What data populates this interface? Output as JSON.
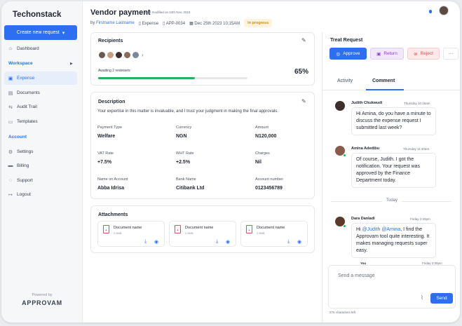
{
  "sidebar": {
    "brand": "Techonstack",
    "new_request": "Create new request",
    "items": [
      {
        "label": "Dashboard",
        "icon": "home-icon"
      },
      {
        "label": "Expense",
        "icon": "wallet-icon"
      },
      {
        "label": "Documents",
        "icon": "file-icon"
      },
      {
        "label": "Audit Trail",
        "icon": "audit-icon"
      },
      {
        "label": "Templates",
        "icon": "template-icon"
      },
      {
        "label": "Settings",
        "icon": "gear-icon"
      },
      {
        "label": "Billing",
        "icon": "card-icon"
      },
      {
        "label": "Support",
        "icon": "support-icon"
      },
      {
        "label": "Logout",
        "icon": "logout-icon"
      }
    ],
    "section_workspace": "Workspace",
    "section_account": "Account",
    "powered_by": "Powered by",
    "product": "APPROVAM"
  },
  "header": {
    "title": "Vendor payment",
    "modified": "Last modified on 24th Nov, 2024",
    "by": "by",
    "author": "Firstname Lastname",
    "category": "Expense",
    "request_id": "APP-0034",
    "date": "Dec 25th 2023 10:15AM",
    "status": "In progress"
  },
  "recipients": {
    "title": "Recipients",
    "awaiting": "Awaiting 2 reviewers",
    "progress_pct": 65,
    "progress_label": "65%"
  },
  "description": {
    "title": "Description",
    "text": "Your expertise in this matter is invaluable, and I trust your judgment in making the final approvals.",
    "fields": [
      {
        "label": "Payment Type",
        "value": "Welfare"
      },
      {
        "label": "Currency",
        "value": "NGN"
      },
      {
        "label": "Amount",
        "value": "N120,000"
      },
      {
        "label": "VAT Rate",
        "value": "+7.5%"
      },
      {
        "label": "WHT Rate",
        "value": "+2.5%"
      },
      {
        "label": "Charges",
        "value": "Nil"
      },
      {
        "label": "Name on Account",
        "value": "Abba Idrisa"
      },
      {
        "label": "Bank Name",
        "value": "Citibank Ltd"
      },
      {
        "label": "Account number",
        "value": "0123456789"
      }
    ]
  },
  "attachments": {
    "title": "Attachments",
    "files": [
      {
        "name": "Document name",
        "size": "2.5MB"
      },
      {
        "name": "Document name",
        "size": "2.5MB"
      },
      {
        "name": "Document name",
        "size": "2.5MB"
      }
    ]
  },
  "treat": {
    "title": "Treat Request",
    "approve": "Approve",
    "return": "Return",
    "reject": "Reject"
  },
  "tabs": {
    "activity": "Activity",
    "comment": "Comment"
  },
  "comments": [
    {
      "name": "Judith Chukwudi",
      "time": "Thursday 10:16am",
      "text": "Hi Amina, do you have a minute to discuss the expense request I submitted last week?"
    },
    {
      "name": "Amina Adedibu",
      "time": "Thursday 11:40am",
      "text": "Of course, Judith. I got the notification. Your request was approved by the Finance Department today."
    },
    {
      "name": "Dara Danladi",
      "time": "Friday 2:20pm",
      "text_pre": "Hi ",
      "mention1": "@Judith",
      "text_mid": " ",
      "mention2": "@Amina",
      "text_post": ", I find the Approvam tool quite interesting. It makes managing requests super easy."
    }
  ],
  "today_label": "Today",
  "next_preview": {
    "name": "You",
    "time": "Friday 2:30pm"
  },
  "composer": {
    "placeholder": "Send a message",
    "send": "Send",
    "chars_left": "275 characters left"
  },
  "colors": {
    "accent": "#2d6ff0",
    "success": "#23b25a",
    "warning": "#d7890c",
    "danger": "#e05252",
    "purple": "#8b3fd0"
  }
}
